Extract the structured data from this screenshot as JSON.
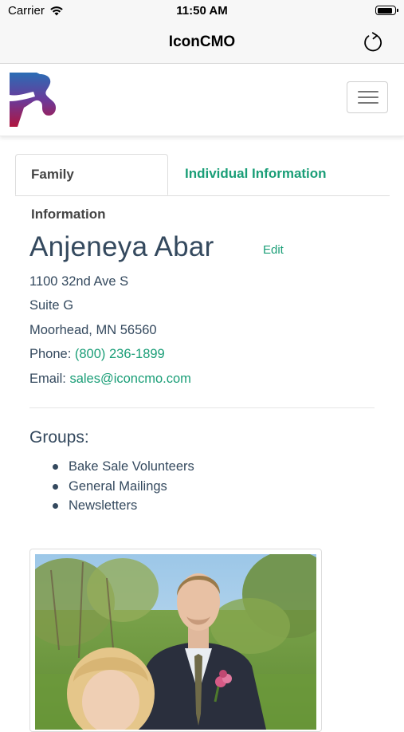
{
  "status_bar": {
    "carrier": "Carrier",
    "time": "11:50 AM",
    "battery_level": 0.9
  },
  "nav": {
    "title": "IconCMO",
    "refresh_icon": "refresh-icon"
  },
  "header": {
    "logo_icon": "iconcmo-logo",
    "menu_icon": "hamburger-menu-icon"
  },
  "tabs": [
    {
      "label": "Family Information",
      "active": true
    },
    {
      "label": "Individual Information",
      "active": false
    }
  ],
  "profile": {
    "name": "Anjeneya Abar",
    "edit_label": "Edit",
    "address_line1": "1100 32nd Ave S",
    "address_line2": "Suite G",
    "city_state_zip": "Moorhead, MN 56560",
    "phone_label": "Phone:",
    "phone": "(800) 236-1899",
    "email_label": "Email:",
    "email": "sales@iconcmo.com"
  },
  "groups": {
    "heading": "Groups:",
    "items": [
      "Bake Sale Volunteers",
      "General Mailings",
      "Newsletters"
    ]
  },
  "colors": {
    "accent": "#1a9e77",
    "text": "#34495e",
    "nav_bg": "#f7f7f7"
  }
}
